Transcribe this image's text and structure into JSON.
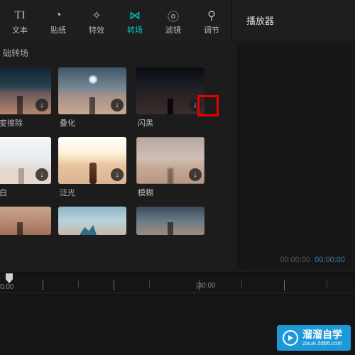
{
  "tabs": {
    "text": {
      "label": "文本",
      "icon": "TI"
    },
    "sticker": {
      "label": "贴纸",
      "icon": "◔"
    },
    "effect": {
      "label": "特效",
      "icon": "✧"
    },
    "trans": {
      "label": "转场",
      "icon": "⋈"
    },
    "filter": {
      "label": "滤镜",
      "icon": "ⓞ"
    },
    "adjust": {
      "label": "调节",
      "icon": "⚲"
    }
  },
  "player_tab": "播放器",
  "section_title": "础转场",
  "items": {
    "r1c1": "斩变擦除",
    "r1c2": "叠化",
    "r1c3": "闪黑",
    "r2c1": "闪白",
    "r2c2": "泛光",
    "r2c3": "模糊"
  },
  "dl_icon": "↓",
  "timecode_a": "00:00:00",
  "timecode_b": "00:00:00",
  "timeline": {
    "t0": "0:00",
    "t1": "|30:00"
  },
  "watermark": {
    "cn": "溜溜自学",
    "url": "zixue.3d66.com"
  }
}
